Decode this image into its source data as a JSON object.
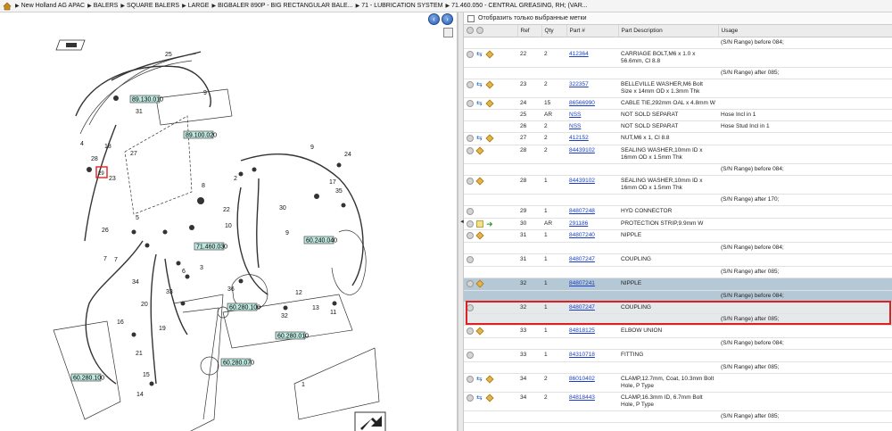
{
  "breadcrumb": [
    "New Holland AG APAC",
    "BALERS",
    "SQUARE BALERS",
    "LARGE",
    "BIGBALER 890P - BIG RECTANGULAR BALE...",
    "71 - LUBRICATION SYSTEM",
    "71.460.050 - CENTRAL GREASING, RH; (VAR..."
  ],
  "filter": {
    "label": "Отобразить только выбранные метки"
  },
  "table": {
    "headers": [
      "Ref",
      "Qty",
      "Part #",
      "Part Description",
      "Usage"
    ],
    "rows": [
      {
        "kind": "usage",
        "usage": "(S/N Range) before 084;"
      },
      {
        "kind": "part",
        "icons": [
          "plus",
          "swap",
          "box"
        ],
        "ref": "22",
        "qty": "2",
        "part": "412364",
        "desc": "CARRIAGE BOLT,M6 x 1.0 x 56.6mm, Cl 8.8",
        "usage": ""
      },
      {
        "kind": "usage",
        "usage": "(S/N Range) after 085;"
      },
      {
        "kind": "part",
        "icons": [
          "plus",
          "swap",
          "box"
        ],
        "ref": "23",
        "qty": "2",
        "part": "322357",
        "desc": "BELLEVILLE WASHER,M6 Bolt Size x 14mm OD x 1.3mm Thk",
        "usage": ""
      },
      {
        "kind": "part",
        "icons": [
          "plus",
          "swap",
          "box"
        ],
        "ref": "24",
        "qty": "15",
        "part": "86566990",
        "desc": "CABLE TIE,292mm OAL x 4.8mm W",
        "usage": ""
      },
      {
        "kind": "part",
        "icons": [],
        "ref": "25",
        "qty": "AR",
        "part": "NSS",
        "desc": "NOT SOLD SEPARAT",
        "usage": "Hose Incl in 1"
      },
      {
        "kind": "part",
        "icons": [],
        "ref": "26",
        "qty": "2",
        "part": "NSS",
        "desc": "NOT SOLD SEPARAT",
        "usage": "Hose Stud Incl in 1"
      },
      {
        "kind": "part",
        "icons": [
          "plus",
          "swap",
          "box"
        ],
        "ref": "27",
        "qty": "2",
        "part": "412152",
        "desc": "NUT,M6 x 1, Cl 8.8",
        "usage": ""
      },
      {
        "kind": "part",
        "icons": [
          "plus",
          "box"
        ],
        "ref": "28",
        "qty": "2",
        "part": "84439102",
        "desc": "SEALING WASHER,10mm ID x 16mm OD x 1.5mm Thk",
        "usage": ""
      },
      {
        "kind": "usage",
        "usage": "(S/N Range) before 084;"
      },
      {
        "kind": "part",
        "icons": [
          "plus",
          "box"
        ],
        "ref": "28",
        "qty": "1",
        "part": "84439102",
        "desc": "SEALING WASHER,10mm ID x 16mm OD x 1.5mm Thk",
        "usage": ""
      },
      {
        "kind": "usage",
        "usage": "(S/N Range) after 170;"
      },
      {
        "kind": "part",
        "icons": [
          "plus"
        ],
        "ref": "29",
        "qty": "1",
        "part": "84807248",
        "desc": "HYD CONNECTOR",
        "usage": ""
      },
      {
        "kind": "part",
        "icons": [
          "plus",
          "note",
          "green"
        ],
        "ref": "30",
        "qty": "AR",
        "part": "291186",
        "desc": "PROTECTION STRIP,9.9mm W",
        "usage": ""
      },
      {
        "kind": "part",
        "icons": [
          "plus",
          "box"
        ],
        "ref": "31",
        "qty": "1",
        "part": "84807240",
        "desc": "NIPPLE",
        "usage": ""
      },
      {
        "kind": "usage",
        "usage": "(S/N Range) before 084;"
      },
      {
        "kind": "part",
        "icons": [
          "plus"
        ],
        "ref": "31",
        "qty": "1",
        "part": "84807247",
        "desc": "COUPLING",
        "usage": ""
      },
      {
        "kind": "usage",
        "usage": "(S/N Range) after 085;"
      },
      {
        "kind": "part",
        "icons": [
          "plus",
          "box"
        ],
        "ref": "32",
        "qty": "1",
        "part": "84807241",
        "desc": "NIPPLE",
        "usage": "",
        "style": "sel"
      },
      {
        "kind": "usage",
        "usage": "(S/N Range) before 084;",
        "style": "sel"
      },
      {
        "kind": "part",
        "icons": [
          "plus"
        ],
        "ref": "32",
        "qty": "1",
        "part": "84807247",
        "desc": "COUPLING",
        "usage": "",
        "style": "hi"
      },
      {
        "kind": "usage",
        "usage": "(S/N Range) after 085;",
        "style": "hi"
      },
      {
        "kind": "part",
        "icons": [
          "plus",
          "box"
        ],
        "ref": "33",
        "qty": "1",
        "part": "84818125",
        "desc": "ELBOW UNION",
        "usage": ""
      },
      {
        "kind": "usage",
        "usage": "(S/N Range) before 084;"
      },
      {
        "kind": "part",
        "icons": [
          "plus"
        ],
        "ref": "33",
        "qty": "1",
        "part": "84310718",
        "desc": "FITTING",
        "usage": ""
      },
      {
        "kind": "usage",
        "usage": "(S/N Range) after 085;"
      },
      {
        "kind": "part",
        "icons": [
          "plus",
          "swap",
          "box"
        ],
        "ref": "34",
        "qty": "2",
        "part": "86010402",
        "desc": "CLAMP,12.7mm, Coat, 10.3mm Bolt Hole, P Type",
        "usage": ""
      },
      {
        "kind": "part",
        "icons": [
          "plus",
          "swap",
          "box"
        ],
        "ref": "34",
        "qty": "2",
        "part": "84818443",
        "desc": "CLAMP,16.3mm ID, 6.7mm Bolt Hole, P Type",
        "usage": ""
      },
      {
        "kind": "usage",
        "usage": "(S/N Range) after 085;"
      }
    ]
  },
  "diagram": {
    "callouts": [
      "89.130.010",
      "89.100.020",
      "71.460.030",
      "60.240.040",
      "60.280.100",
      "60.280.010",
      "60.280.070",
      "60.280.100"
    ],
    "refs": [
      "25",
      "9",
      "31",
      "18",
      "4",
      "27",
      "28",
      "23",
      "26",
      "7",
      "30",
      "10",
      "22",
      "8",
      "5",
      "3",
      "6",
      "9",
      "24",
      "17",
      "35",
      "2",
      "33",
      "20",
      "19",
      "16",
      "21",
      "15",
      "14",
      "12",
      "13",
      "11",
      "36",
      "7",
      "9",
      "1",
      "32",
      "34",
      "29"
    ],
    "highlight_ref": "29"
  }
}
